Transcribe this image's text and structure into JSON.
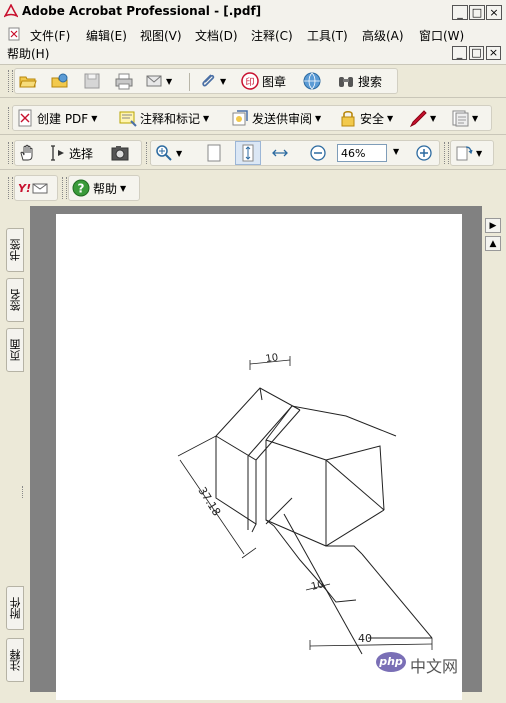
{
  "window": {
    "title": "Adobe Acrobat Professional - [.pdf]",
    "minimize": "_",
    "maximize": "□",
    "close": "×"
  },
  "menu": {
    "items": [
      "文件(F)",
      "编辑(E)",
      "视图(V)",
      "文档(D)",
      "注释(C)",
      "工具(T)",
      "高级(A)",
      "窗口(W)",
      "帮助(H)"
    ],
    "doc_controls": [
      "_",
      "□",
      "×"
    ]
  },
  "toolbar1": {
    "stamp_label": "图章",
    "search_label": "搜索"
  },
  "toolbar2": {
    "create_pdf": "创建 PDF",
    "comment_markup": "注释和标记",
    "send_review": "发送供审阅",
    "security": "安全"
  },
  "toolbar3": {
    "select_label": "选择",
    "zoom_value": "46%"
  },
  "toolbar4": {
    "help_label": "帮助",
    "yahoo_label": "Y!"
  },
  "left_tabs": [
    "书签",
    "签名",
    "页面",
    "附件",
    "注释"
  ],
  "drawing": {
    "dim_top": "10",
    "dim_side": "37.18",
    "dim_bottom_small": "10",
    "dim_bottom": "40"
  },
  "watermark": {
    "logo": "php",
    "text": "中文网"
  },
  "colors": {
    "accent_red": "#c8102e",
    "doc_background": "#818181",
    "ui_background": "#ece9d8"
  }
}
